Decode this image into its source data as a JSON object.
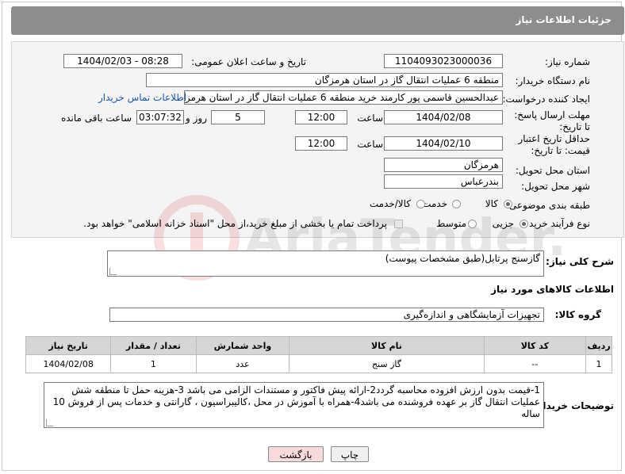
{
  "header": {
    "title": "جزئیات اطلاعات نیاز"
  },
  "form": {
    "need_number_label": "شماره نیاز:",
    "need_number": "1104093023000036",
    "announce_label": "تاریخ و ساعت اعلان عمومی:",
    "announce_value": "1404/02/03 - 08:28",
    "buyer_org_label": "نام دستگاه خریدار:",
    "buyer_org": "منطقه 6 عملیات انتقال گاز در استان هرمزگان",
    "requester_label": "ایجاد کننده درخواست:",
    "requester": "عبدالحسین قاسمی پور کارمند خرید منطقه 6 عملیات انتقال گاز در استان هرمزگ",
    "contact_link": "اطلاعات تماس خریدار",
    "deadline_label": "مهلت ارسال پاسخ: تا تاریخ:",
    "deadline_date": "1404/02/08",
    "hour_label": "ساعت",
    "deadline_hour": "12:00",
    "days_value": "5",
    "days_label": "روز و",
    "remaining_time": "03:07:32",
    "remaining_label": "ساعت باقی مانده",
    "price_validity_label": "حداقل تاریخ اعتبار قیمت: تا تاریخ:",
    "price_validity_date": "1404/02/10",
    "price_validity_hour": "12:00",
    "province_label": "استان محل تحویل:",
    "province": "هرمزگان",
    "city_label": "شهر محل تحویل:",
    "city": "بندرعباس",
    "category_label": "طبقه بندی موضوعی:",
    "category_options": {
      "goods": "کالا",
      "service": "خدمت",
      "goods_service": "کالا/خدمت"
    },
    "process_label": "نوع فرآیند خرید :",
    "process_options": {
      "minor": "جزیی",
      "medium": "متوسط"
    },
    "payment_note": "پرداخت تمام یا بخشی از مبلغ خرید،از محل \"اسناد خزانه اسلامی\" خواهد بود."
  },
  "description": {
    "label": "شرح کلی نیاز:",
    "value": "گازسنج پرتابل(طبق مشخصات پیوست)"
  },
  "goods_info": {
    "title": "اطلاعات کالاهای مورد نیاز",
    "group_label": "گروه کالا:",
    "group_value": "تجهیزات آزمایشگاهی و اندازه‌گیری"
  },
  "table": {
    "headers": [
      "ردیف",
      "کد کالا",
      "نام کالا",
      "واحد شمارش",
      "تعداد / مقدار",
      "تاریخ نیاز"
    ],
    "rows": [
      [
        "1",
        "--",
        "گاز سنج",
        "عدد",
        "1",
        "1404/02/08"
      ]
    ]
  },
  "buyer_notes": {
    "label": "توضیحات خریدار:",
    "value": "1-قیمت بدون ارزش افزوده محاسبه گردد2-ارائه پیش فاکتور و مستندات الزامی می باشد 3-هزینه حمل تا منطقه شش عملیات انتقال گاز بر عهده فروشنده می باشد4-همراه با آموزش در محل ،کالیبراسیون ، گارانتی و خدمات پس از فروش 10 ساله"
  },
  "buttons": {
    "print": "چاپ",
    "back": "بازگشت"
  },
  "watermark": {
    "text": "AriaTender.neT"
  },
  "colors": {
    "header": "#8d8d8d",
    "link": "#1a55b5",
    "back_button": "#f7dada"
  }
}
